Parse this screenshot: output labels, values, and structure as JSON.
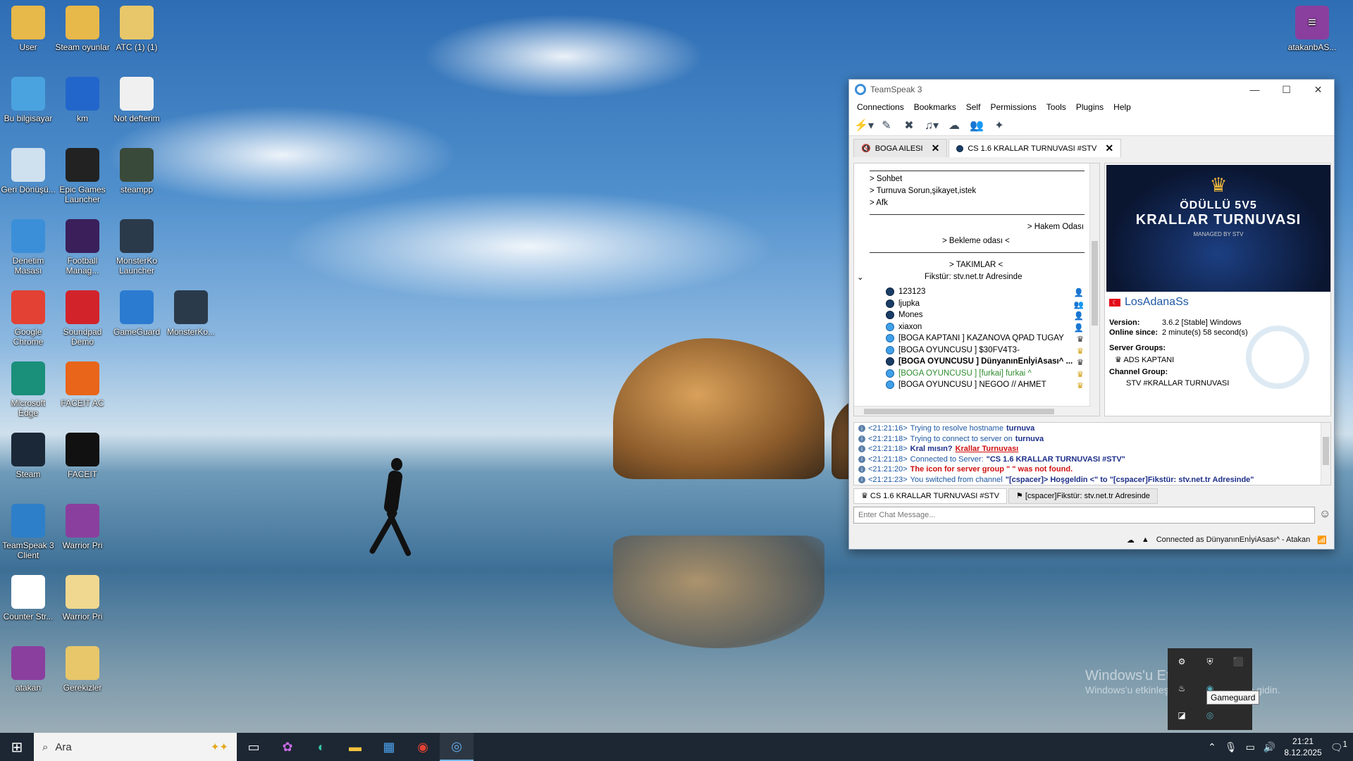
{
  "desktop_icons": [
    {
      "label": "User",
      "icon": "user-folder-icon",
      "color": "#e7b84a",
      "col": 0,
      "row": 0
    },
    {
      "label": "Steam oyunlar",
      "icon": "folder-icon",
      "color": "#e7b84a",
      "col": 1,
      "row": 0
    },
    {
      "label": "ATC (1) (1)",
      "icon": "folder-icon",
      "color": "#e7c76a",
      "col": 2,
      "row": 0
    },
    {
      "label": "Bu bilgisayar",
      "icon": "computer-icon",
      "color": "#4aa3df",
      "col": 0,
      "row": 1
    },
    {
      "label": "km",
      "icon": "cs-icon",
      "color": "#2266cc",
      "col": 1,
      "row": 1
    },
    {
      "label": "Not defterim",
      "icon": "notepad-icon",
      "color": "#f0f0f0",
      "col": 2,
      "row": 1
    },
    {
      "label": "Geri Dönüşü...",
      "icon": "recycle-bin-icon",
      "color": "#cfe1ef",
      "col": 0,
      "row": 2
    },
    {
      "label": "Epic Games Launcher",
      "icon": "epic-games-icon",
      "color": "#222222",
      "col": 1,
      "row": 2
    },
    {
      "label": "steampp",
      "icon": "steampp-icon",
      "color": "#3a4a3a",
      "col": 2,
      "row": 2
    },
    {
      "label": "Denetim Masası",
      "icon": "control-panel-icon",
      "color": "#3b8fd8",
      "col": 0,
      "row": 3
    },
    {
      "label": "Football Manag...",
      "icon": "football-manager-icon",
      "color": "#3a1f5a",
      "col": 1,
      "row": 3
    },
    {
      "label": "MonsterKo Launcher",
      "icon": "monsterko-icon",
      "color": "#2b3a4a",
      "col": 2,
      "row": 3
    },
    {
      "label": "Google Chrome",
      "icon": "chrome-icon",
      "color": "#e34133",
      "col": 0,
      "row": 4
    },
    {
      "label": "Soundpad Demo",
      "icon": "soundpad-icon",
      "color": "#d3232a",
      "col": 1,
      "row": 4
    },
    {
      "label": "GameGuard",
      "icon": "gameguard-icon",
      "color": "#2b7bd1",
      "col": 2,
      "row": 4
    },
    {
      "label": "MonsterKo...",
      "icon": "monsterko-icon",
      "color": "#2b3a4a",
      "col": 3,
      "row": 4
    },
    {
      "label": "Microsoft Edge",
      "icon": "edge-icon",
      "color": "#1a8f7a",
      "col": 0,
      "row": 5
    },
    {
      "label": "FACEIT AC",
      "icon": "faceit-ac-icon",
      "color": "#e8651a",
      "col": 1,
      "row": 5
    },
    {
      "label": "Steam",
      "icon": "steam-icon",
      "color": "#1b2838",
      "col": 0,
      "row": 6
    },
    {
      "label": "FACEIT",
      "icon": "faceit-icon",
      "color": "#111111",
      "col": 1,
      "row": 6
    },
    {
      "label": "TeamSpeak 3 Client",
      "icon": "teamspeak-icon",
      "color": "#2d7fc9",
      "col": 0,
      "row": 7
    },
    {
      "label": "Warrior Pri",
      "icon": "winrar-icon",
      "color": "#8a3f9e",
      "col": 1,
      "row": 7
    },
    {
      "label": "Counter Str...",
      "icon": "counter-strike-icon",
      "color": "#ffffff",
      "col": 0,
      "row": 8
    },
    {
      "label": "Warrior Pri",
      "icon": "folder-icon",
      "color": "#f0d890",
      "col": 1,
      "row": 8
    },
    {
      "label": "atakan",
      "icon": "winrar-icon",
      "color": "#8a3f9e",
      "col": 0,
      "row": 9
    },
    {
      "label": "Gerekizler",
      "icon": "folder-icon",
      "color": "#e7c76a",
      "col": 1,
      "row": 9
    }
  ],
  "top_right_icon": {
    "label": "atakanbAS...",
    "icon": "winrar-icon"
  },
  "window": {
    "title": "TeamSpeak 3",
    "menu": [
      "Connections",
      "Bookmarks",
      "Self",
      "Permissions",
      "Tools",
      "Plugins",
      "Help"
    ],
    "tabs": [
      {
        "label": "BOGA AILESI"
      },
      {
        "label": "CS 1.6 KRALLAR TURNUVASI #STV"
      }
    ],
    "tree": {
      "rows": [
        {
          "text": "> Sohbet",
          "align": "left"
        },
        {
          "text": "> Turnuva Sorun,şikayet,istek",
          "align": "left"
        },
        {
          "text": "> Afk",
          "align": "left"
        },
        {
          "text": "> Hakem Odası",
          "align": "right"
        },
        {
          "text": "> Bekleme odası <",
          "align": "center"
        },
        {
          "text": "> TAKIMLAR <",
          "align": "center"
        },
        {
          "text": "Fikstür: stv.net.tr  Adresinde",
          "align": "center"
        }
      ],
      "clients": [
        {
          "name": "123123",
          "color": "#000000",
          "bold": false,
          "lit": false,
          "icon": "user-icon"
        },
        {
          "name": "ljupka",
          "color": "#000000",
          "bold": false,
          "lit": false,
          "icon": "group-icon"
        },
        {
          "name": "Mones",
          "color": "#000000",
          "bold": false,
          "lit": false,
          "icon": "user-icon"
        },
        {
          "name": "xiaxon",
          "color": "#000000",
          "bold": false,
          "lit": true,
          "icon": "user-icon"
        },
        {
          "name": "[BOGA KAPTANI ] KAZANOVA QPAD TUGAY",
          "color": "#000000",
          "bold": false,
          "lit": true,
          "icon": "crown-icon"
        },
        {
          "name": "[BOGA OYUNCUSU ] $30FV4T3-",
          "color": "#000000",
          "bold": false,
          "lit": true,
          "icon": "gold-crown-icon"
        },
        {
          "name": "[BOGA OYUNCUSU ] DünyanınEnİyiAsası^ ...",
          "color": "#000000",
          "bold": true,
          "lit": false,
          "icon": "crown-icon"
        },
        {
          "name": "[BOGA OYUNCUSU ] [furkai] furkai ^",
          "color": "#2e8b2e",
          "bold": false,
          "lit": true,
          "icon": "gold-crown-icon"
        },
        {
          "name": "[BOGA OYUNCUSU ] NEGOO // AHMET",
          "color": "#000000",
          "bold": false,
          "lit": true,
          "icon": "gold-crown-icon"
        }
      ]
    },
    "info": {
      "banner": {
        "line1": "ÖDÜLLÜ 5V5",
        "line2": "KRALLAR TURNUVASI",
        "line3": "MANAGED BY STV"
      },
      "server_name": "LosAdanaSs",
      "version_label": "Version:",
      "version_value": "3.6.2 [Stable] Windows",
      "online_label": "Online since:",
      "online_value": "2 minute(s) 58 second(s)",
      "server_groups_label": "Server Groups:",
      "server_group": "ADS KAPTANI",
      "channel_group_label": "Channel Group:",
      "channel_group": "STV #KRALLAR TURNUVASI"
    },
    "log": [
      {
        "time": "<21:21:16>",
        "text": "Trying to resolve hostname ",
        "strong": "turnuva",
        "style": "normal"
      },
      {
        "time": "<21:21:18>",
        "text": "Trying to connect to server on ",
        "strong": "turnuva",
        "style": "normal"
      },
      {
        "time": "<21:21:18>",
        "text": "Kral mısın? ",
        "strong": "Krallar Turnuvası",
        "style": "welcome"
      },
      {
        "time": "<21:21:18>",
        "text": "Connected to Server: ",
        "strong": "\"CS 1.6 KRALLAR TURNUVASI #STV\"",
        "style": "normal"
      },
      {
        "time": "<21:21:20>",
        "text": "The icon for server group \"  \" was not found.",
        "strong": "",
        "style": "error"
      },
      {
        "time": "<21:21:23>",
        "text": "You switched from channel ",
        "strong": "\"[cspacer]> Hoşgeldin <\" to \"[cspacer]Fikstür: stv.net.tr  Adresinde\"",
        "style": "normal"
      }
    ],
    "chat_tabs": [
      "CS 1.6 KRALLAR TURNUVASI #STV",
      "[cspacer]Fikstür: stv.net.tr  Adresinde"
    ],
    "chat_placeholder": "Enter Chat Message...",
    "status_text": "Connected as DünyanınEnİyiAsası^ - Atakan"
  },
  "taskbar": {
    "search_placeholder": "Ara",
    "time": "21:21",
    "date": "8.12.2025",
    "notification_count": "1"
  },
  "tray_flyout": {
    "tooltip": "Gameguard"
  },
  "activation": {
    "line1": "Windows'u Etkinleştir",
    "line2": "Windows'u etkinleştirmek için Ayarlar'a gidin."
  }
}
